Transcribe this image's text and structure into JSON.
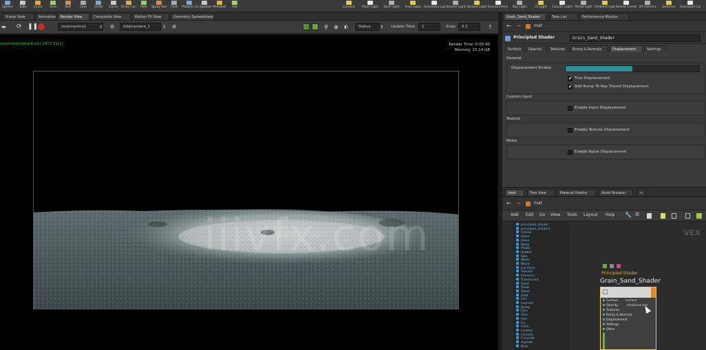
{
  "shelf": {
    "tools_left": [
      "Sphere",
      "Tube",
      "Circle",
      "Grid",
      "Null",
      "Line",
      "Circle",
      "Curve",
      "Draw Curve",
      "Path",
      "Spray Paint",
      "Font",
      "Platonic Solids",
      "L-System",
      "Metaball",
      "File"
    ],
    "tools_right": [
      "Camera",
      "Point Light",
      "Spot Light",
      "Area Light",
      "Geometry Light",
      "Volume Light",
      "Distant Light",
      "Environment Light",
      "Sky Light",
      "GI Light",
      "Caustic Light",
      "Portal Light",
      "Ambient Light",
      "Stereo Camera",
      "VR Camera",
      "Switcher",
      "Gamepad Camera"
    ]
  },
  "viewport_tabs": [
    "Scene View",
    "Animation Editor",
    "Render View",
    "Composite View",
    "Motion FX View",
    "Geometry Spreadsheet"
  ],
  "right_tabs": [
    "Grain_Sand_Shader",
    "Take List",
    "Performance Monitor"
  ],
  "viewport_toolbar": {
    "render_node": "/out/mantra1",
    "camera": "/obj/camera_1",
    "status": "Status",
    "update_time_label": "Update Time",
    "update_time": "1",
    "snap_label": "Snap",
    "snap_value": "0.2"
  },
  "render": {
    "status_line": "mantra(ipr)(mantra1) 1672:31[1]",
    "render_time_label": "Render Time:",
    "render_time": "0:00:40",
    "memory_label": "Memory:",
    "memory": "15.14 GB"
  },
  "watermark": "iiivfx.com",
  "params": {
    "path": "mat",
    "node_type": "Principled Shader",
    "node_name": "Grain_Sand_Shader",
    "tabs": [
      "Surface",
      "Opacity",
      "Textures",
      "Bump & Normals",
      "Displacement",
      "Settings"
    ],
    "active_tab_index": 4,
    "general_label": "General",
    "displacement_label": "Displacement Enable",
    "displacement_value": 0.5,
    "true_displacement": "True Displacement",
    "add_bump": "Add Bump To Ray Traced Displacement",
    "sections": [
      {
        "title": "Custom Input",
        "option": "Enable Input Displacement"
      },
      {
        "title": "Texture",
        "option": "Enable Texture Displacement"
      },
      {
        "title": "Noise",
        "option": "Enable Noise Displacement"
      }
    ]
  },
  "network": {
    "tabs": [
      "/mat",
      "Tree View",
      "Material Palette",
      "Asset Browser"
    ],
    "path": "mat",
    "menu": [
      "Add",
      "Edit",
      "Go",
      "View",
      "Tools",
      "Layout",
      "Help"
    ],
    "context_label": "VEX",
    "tab_menu_items": [
      "principled_shader",
      "principled_shader2",
      "Classic",
      "Glass",
      "Glass",
      "Metal",
      "Plastic",
      "Rubber",
      "Skin",
      "Water",
      "Wood",
      "Car Paint",
      "Volume",
      "Emission",
      "Translucent",
      "Sand",
      "Snow",
      "Stone",
      "Gold",
      "Iron",
      "Layered",
      "Bump",
      "Pyro",
      "Toon",
      "Hair",
      "Fur",
      "Cloth",
      "Leather",
      "Ceramic",
      "Concrete",
      "Asphalt",
      "Bark"
    ],
    "node": {
      "type_label": "Principled Shader",
      "name": "Grain_Sand_Shader",
      "ports": [
        "Surface",
        "Opacity",
        "Textures",
        "Bump & Normals",
        "Displacement",
        "Settings",
        "Other"
      ],
      "outputs": [
        "surface",
        "displacement"
      ]
    }
  },
  "colors": {
    "accent_teal": "#2e8f96",
    "status_green": "#32d24b",
    "node_border": "#e8d060",
    "node_flag": "#e0882a"
  }
}
